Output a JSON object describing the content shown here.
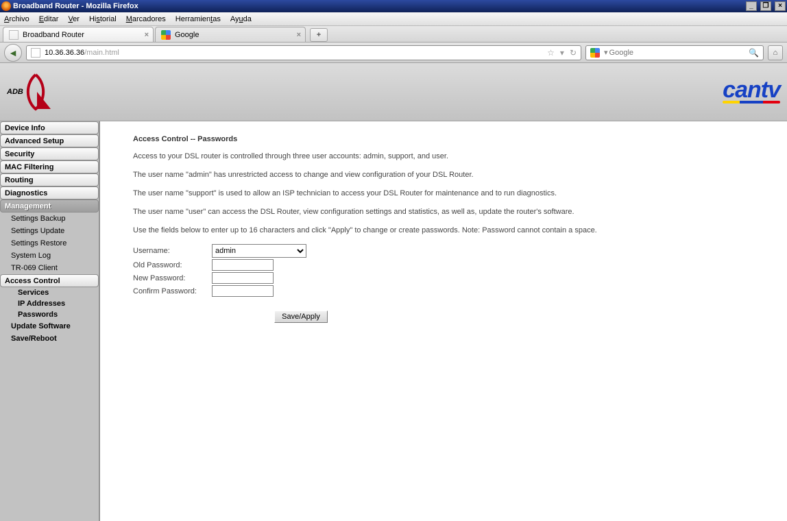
{
  "window": {
    "title": "Broadband Router - Mozilla Firefox",
    "min": "_",
    "max": "❐",
    "close": "×"
  },
  "menus": [
    "Archivo",
    "Editar",
    "Ver",
    "Historial",
    "Marcadores",
    "Herramientas",
    "Ayuda"
  ],
  "tabs": {
    "active": "Broadband Router",
    "inactive": "Google",
    "newtab": "+"
  },
  "url": {
    "host": "10.36.36.36",
    "path": "/main.html"
  },
  "search": {
    "placeholder": "Google"
  },
  "brand": {
    "left": "ADB",
    "right": "cantv"
  },
  "sidebar": {
    "items": [
      {
        "label": "Device Info"
      },
      {
        "label": "Advanced Setup"
      },
      {
        "label": "Security"
      },
      {
        "label": "MAC Filtering"
      },
      {
        "label": "Routing"
      },
      {
        "label": "Diagnostics"
      }
    ],
    "active": "Management",
    "subs": {
      "settings_backup": "Settings Backup",
      "settings_update": "Settings Update",
      "settings_restore": "Settings Restore",
      "system_log": "System Log",
      "tr069": "TR-069 Client",
      "access_control": "Access Control",
      "services": "Services",
      "ip_addresses": "IP Addresses",
      "passwords": "Passwords",
      "update_software": "Update Software",
      "save_reboot": "Save/Reboot"
    }
  },
  "content": {
    "heading": "Access Control -- Passwords",
    "p1": "Access to your DSL router is controlled through three user accounts: admin, support, and user.",
    "p2": "The user name \"admin\" has unrestricted access to change and view configuration of your DSL Router.",
    "p3": "The user name \"support\" is used to allow an ISP technician to access your DSL Router for maintenance and to run diagnostics.",
    "p4": "The user name \"user\" can access the DSL Router, view configuration settings and statistics, as well as, update the router's software.",
    "p5": "Use the fields below to enter up to 16 characters and click \"Apply\" to change or create passwords. Note: Password cannot contain a space."
  },
  "form": {
    "username_label": "Username:",
    "username_value": "admin",
    "old_label": "Old Password:",
    "new_label": "New Password:",
    "confirm_label": "Confirm Password:",
    "apply": "Save/Apply"
  }
}
